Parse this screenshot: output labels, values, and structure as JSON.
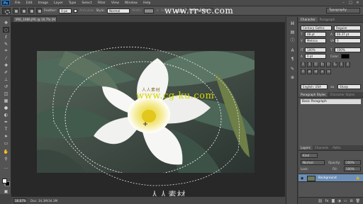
{
  "app": {
    "logo": "Ps"
  },
  "menu": [
    "File",
    "Edit",
    "Image",
    "Layer",
    "Type",
    "Select",
    "Filter",
    "View",
    "Window",
    "Help"
  ],
  "window_controls": [
    "–",
    "□",
    "✕"
  ],
  "options": {
    "feather_label": "Feather:",
    "feather_value": "0 px",
    "antialias_label": "Anti-alias",
    "style_label": "Style:",
    "style_value": "Normal",
    "width_label": "Width:",
    "height_label": "Height:",
    "refine_edge": "Refine Edge..."
  },
  "workspace": "Typography",
  "document": {
    "tab_title": "IMG_1686.JPG @ 16.7% (RGB/8)",
    "zoom": "16.67%",
    "doc_size": "Doc: 34.3M/34.3M"
  },
  "watermarks": {
    "top": "www.rr-sc.com",
    "middle": "www.cg-ku.com",
    "center_cn": "人人素材",
    "bottom_cn": "人人素材"
  },
  "panels": {
    "character_tabs": [
      "Character",
      "Paragraph"
    ],
    "font_family": "Century Gothic",
    "font_style": "Regular",
    "font_size": "48 pt",
    "leading": "60.37 pt",
    "kerning": "Metrics",
    "tracking": "0",
    "vscale": "100%",
    "hscale": "100%",
    "baseline": "0 pt",
    "color_label": "Color:",
    "type_buttons": [
      "T",
      "T",
      "TT",
      "Tt",
      "T¹",
      "T₁",
      "T",
      "T"
    ],
    "language": "English: USA",
    "antialias": "Sharp",
    "para_style_tabs": [
      "Paragraph Styles",
      "Character Styles"
    ],
    "para_style_item": "Basic Paragraph",
    "layers_tabs": [
      "Layers",
      "Channels",
      "Paths"
    ],
    "layer_kind": "Kind",
    "blend_mode": "Normal",
    "opacity_label": "Opacity:",
    "opacity_value": "100%",
    "lock_label": "Lock:",
    "fill_label": "Fill:",
    "fill_value": "100%",
    "layer_name": "Background"
  }
}
